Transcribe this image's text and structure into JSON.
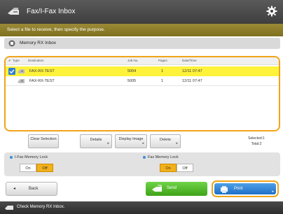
{
  "titlebar": {
    "title": "Fax/I-Fax Inbox",
    "icon": "fax-machine-icon",
    "settings_icon": "gear-icon"
  },
  "instruction": "Select a file to receive, then specify the purpose.",
  "box": {
    "label": "Memory RX Inbox",
    "icon": "inbox-icon"
  },
  "list": {
    "columns": [
      "Type",
      "Destination",
      "Job No.",
      "Pages",
      "Date/Time"
    ],
    "rows": [
      {
        "destination": "FAX-RX-TEST",
        "job_no": "5004",
        "pages": "1",
        "datetime": "12/11 07:47",
        "selected": true
      },
      {
        "destination": "FAX-RX-TEST",
        "job_no": "5005",
        "pages": "1",
        "datetime": "12/11 07:47",
        "selected": false
      }
    ]
  },
  "actions": {
    "clear": "Clear Selection",
    "details": "Details",
    "display_image": "Display Image",
    "delete": "Delete",
    "selected": "Selected:1",
    "total": "Total:2"
  },
  "locks": {
    "ifax_label": "I-Fax Memory Lock",
    "ifax_on": "On",
    "ifax_off": "Off",
    "fax_label": "Fax Memory Lock",
    "fax_on": "On",
    "fax_off": "Off"
  },
  "bottom": {
    "back": "Back",
    "send": "Send",
    "print": "Print"
  },
  "footer": "Check Memory RX Inbox.",
  "colors": {
    "highlight": "#f2a418",
    "selected_row": "#fff23a",
    "send": "#4fb828",
    "print": "#2f7fd6",
    "instruction_bar": "#8c7c2a"
  }
}
